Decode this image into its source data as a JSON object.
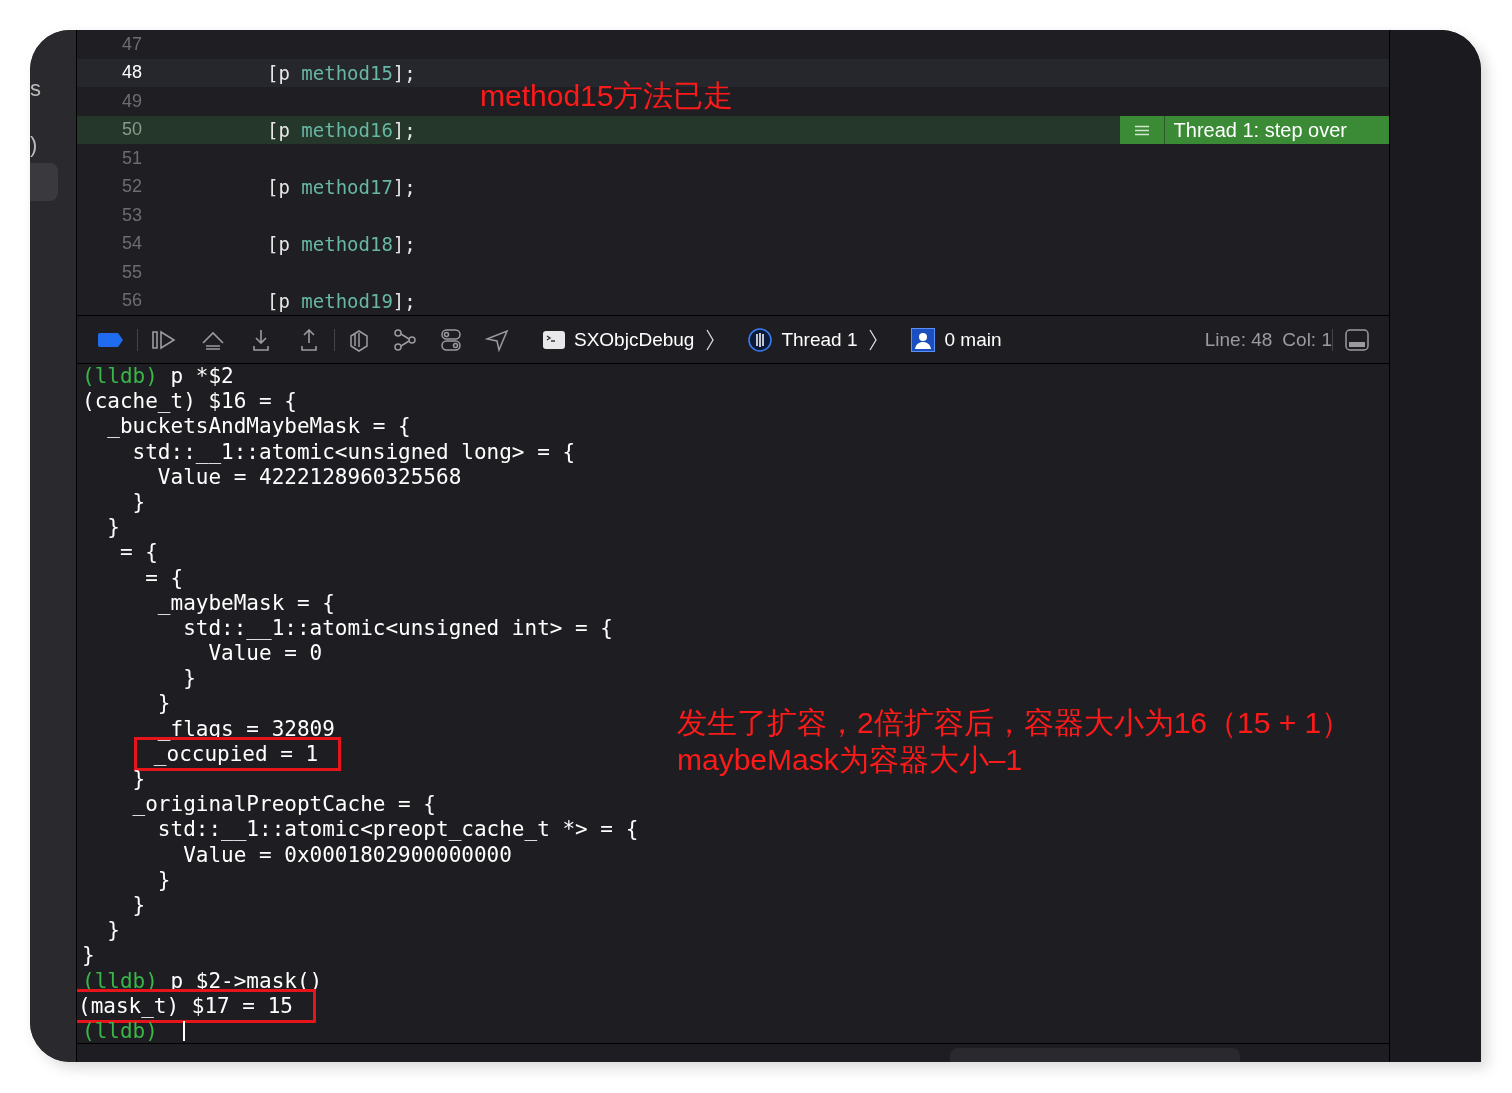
{
  "sidebar": {
    "fragments": [
      "s",
      ")"
    ]
  },
  "editor": {
    "lines": [
      {
        "number": "47",
        "cursor": false,
        "stopped": false
      },
      {
        "number": "48",
        "cursor": true,
        "stopped": false,
        "code": {
          "open": "[p",
          "method": "method15",
          "close": "];"
        }
      },
      {
        "number": "49",
        "cursor": false,
        "stopped": false
      },
      {
        "number": "50",
        "cursor": false,
        "stopped": true,
        "code": {
          "open": "[p",
          "method": "method16",
          "close": "];"
        },
        "badge": "Thread 1: step over"
      },
      {
        "number": "51",
        "cursor": false,
        "stopped": false
      },
      {
        "number": "52",
        "cursor": false,
        "stopped": false,
        "code": {
          "open": "[p",
          "method": "method17",
          "close": "];"
        }
      },
      {
        "number": "53",
        "cursor": false,
        "stopped": false
      },
      {
        "number": "54",
        "cursor": false,
        "stopped": false,
        "code": {
          "open": "[p",
          "method": "method18",
          "close": "];"
        }
      },
      {
        "number": "55",
        "cursor": false,
        "stopped": false
      },
      {
        "number": "56",
        "cursor": false,
        "stopped": false,
        "code": {
          "open": "[p",
          "method": "method19",
          "close": "];"
        }
      }
    ],
    "annotation": "method15方法已走"
  },
  "debug_bar": {
    "breadcrumbs": [
      {
        "kind": "target",
        "label": "SXObjcDebug"
      },
      {
        "kind": "thread",
        "label": "Thread 1"
      },
      {
        "kind": "frame",
        "label": "0 main"
      }
    ],
    "line": "Line: 48",
    "col": "Col: 1"
  },
  "console": {
    "lines": [
      {
        "kind": "prompt",
        "prompt": "(lldb)",
        "text": "p *$2"
      },
      {
        "kind": "output",
        "text": "(cache_t) $16 = {"
      },
      {
        "kind": "output",
        "text": "  _bucketsAndMaybeMask = {"
      },
      {
        "kind": "output",
        "text": "    std::__1::atomic<unsigned long> = {"
      },
      {
        "kind": "output",
        "text": "      Value = 4222128960325568"
      },
      {
        "kind": "output",
        "text": "    }"
      },
      {
        "kind": "output",
        "text": "  }"
      },
      {
        "kind": "output",
        "text": "   = {"
      },
      {
        "kind": "output",
        "text": "     = {"
      },
      {
        "kind": "output",
        "text": "      _maybeMask = {"
      },
      {
        "kind": "output",
        "text": "        std::__1::atomic<unsigned int> = {"
      },
      {
        "kind": "output",
        "text": "          Value = 0"
      },
      {
        "kind": "output",
        "text": "        }"
      },
      {
        "kind": "output",
        "text": "      }"
      },
      {
        "kind": "output",
        "text": "      _flags = 32809"
      },
      {
        "kind": "output",
        "text": "      _occupied = 1",
        "boxed": true
      },
      {
        "kind": "output",
        "text": "    }"
      },
      {
        "kind": "output",
        "text": "    _originalPreoptCache = {"
      },
      {
        "kind": "output",
        "text": "      std::__1::atomic<preopt_cache_t *> = {"
      },
      {
        "kind": "output",
        "text": "        Value = 0x0001802900000000"
      },
      {
        "kind": "output",
        "text": "      }"
      },
      {
        "kind": "output",
        "text": "    }"
      },
      {
        "kind": "output",
        "text": "  }"
      },
      {
        "kind": "output",
        "text": "}"
      },
      {
        "kind": "prompt",
        "prompt": "(lldb)",
        "text": "p $2->mask()"
      },
      {
        "kind": "output",
        "text": "(mask_t) $17 = 15",
        "boxed": true
      },
      {
        "kind": "prompt",
        "prompt": "(lldb)",
        "cursor": true
      }
    ],
    "annotation": [
      "发生了扩容，2倍扩容后，容器大小为16（15 + 1）",
      "maybeMask为容器大小–1"
    ]
  }
}
